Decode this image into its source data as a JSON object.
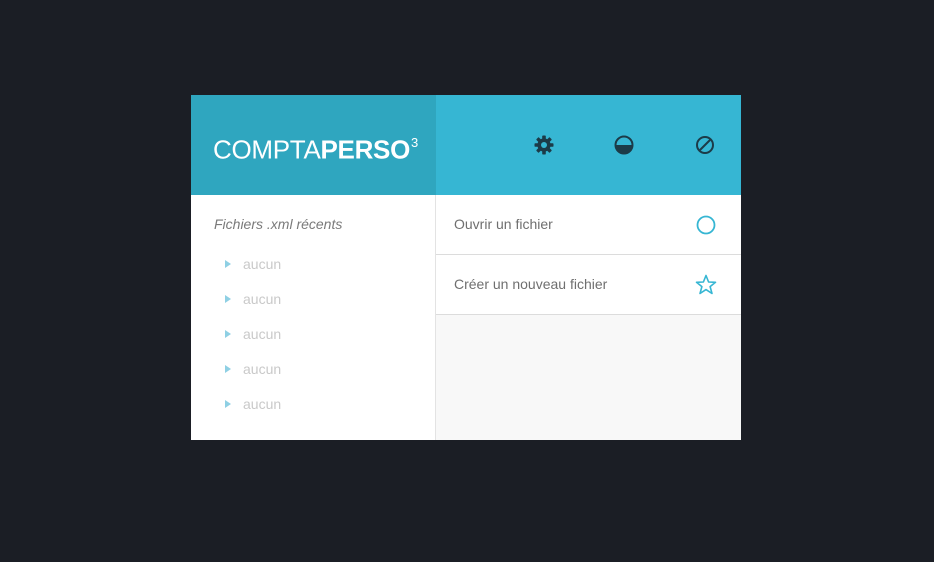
{
  "app": {
    "logo_light": "COMPTA",
    "logo_bold": "PERSO",
    "logo_sup": "3",
    "accent_color": "#36b6d3",
    "logo_bg_color": "#2fa6bf",
    "icon_color": "#1c3b48"
  },
  "header": {
    "icons": [
      "gear-icon",
      "half-circle-icon",
      "slash-circle-icon"
    ]
  },
  "recent": {
    "title": "Fichiers .xml récents",
    "items": [
      {
        "label": "aucun"
      },
      {
        "label": "aucun"
      },
      {
        "label": "aucun"
      },
      {
        "label": "aucun"
      },
      {
        "label": "aucun"
      }
    ]
  },
  "actions": {
    "open_label": "Ouvrir un fichier",
    "open_icon": "circle-icon",
    "new_label": "Créer un nouveau fichier",
    "new_icon": "star-icon"
  }
}
